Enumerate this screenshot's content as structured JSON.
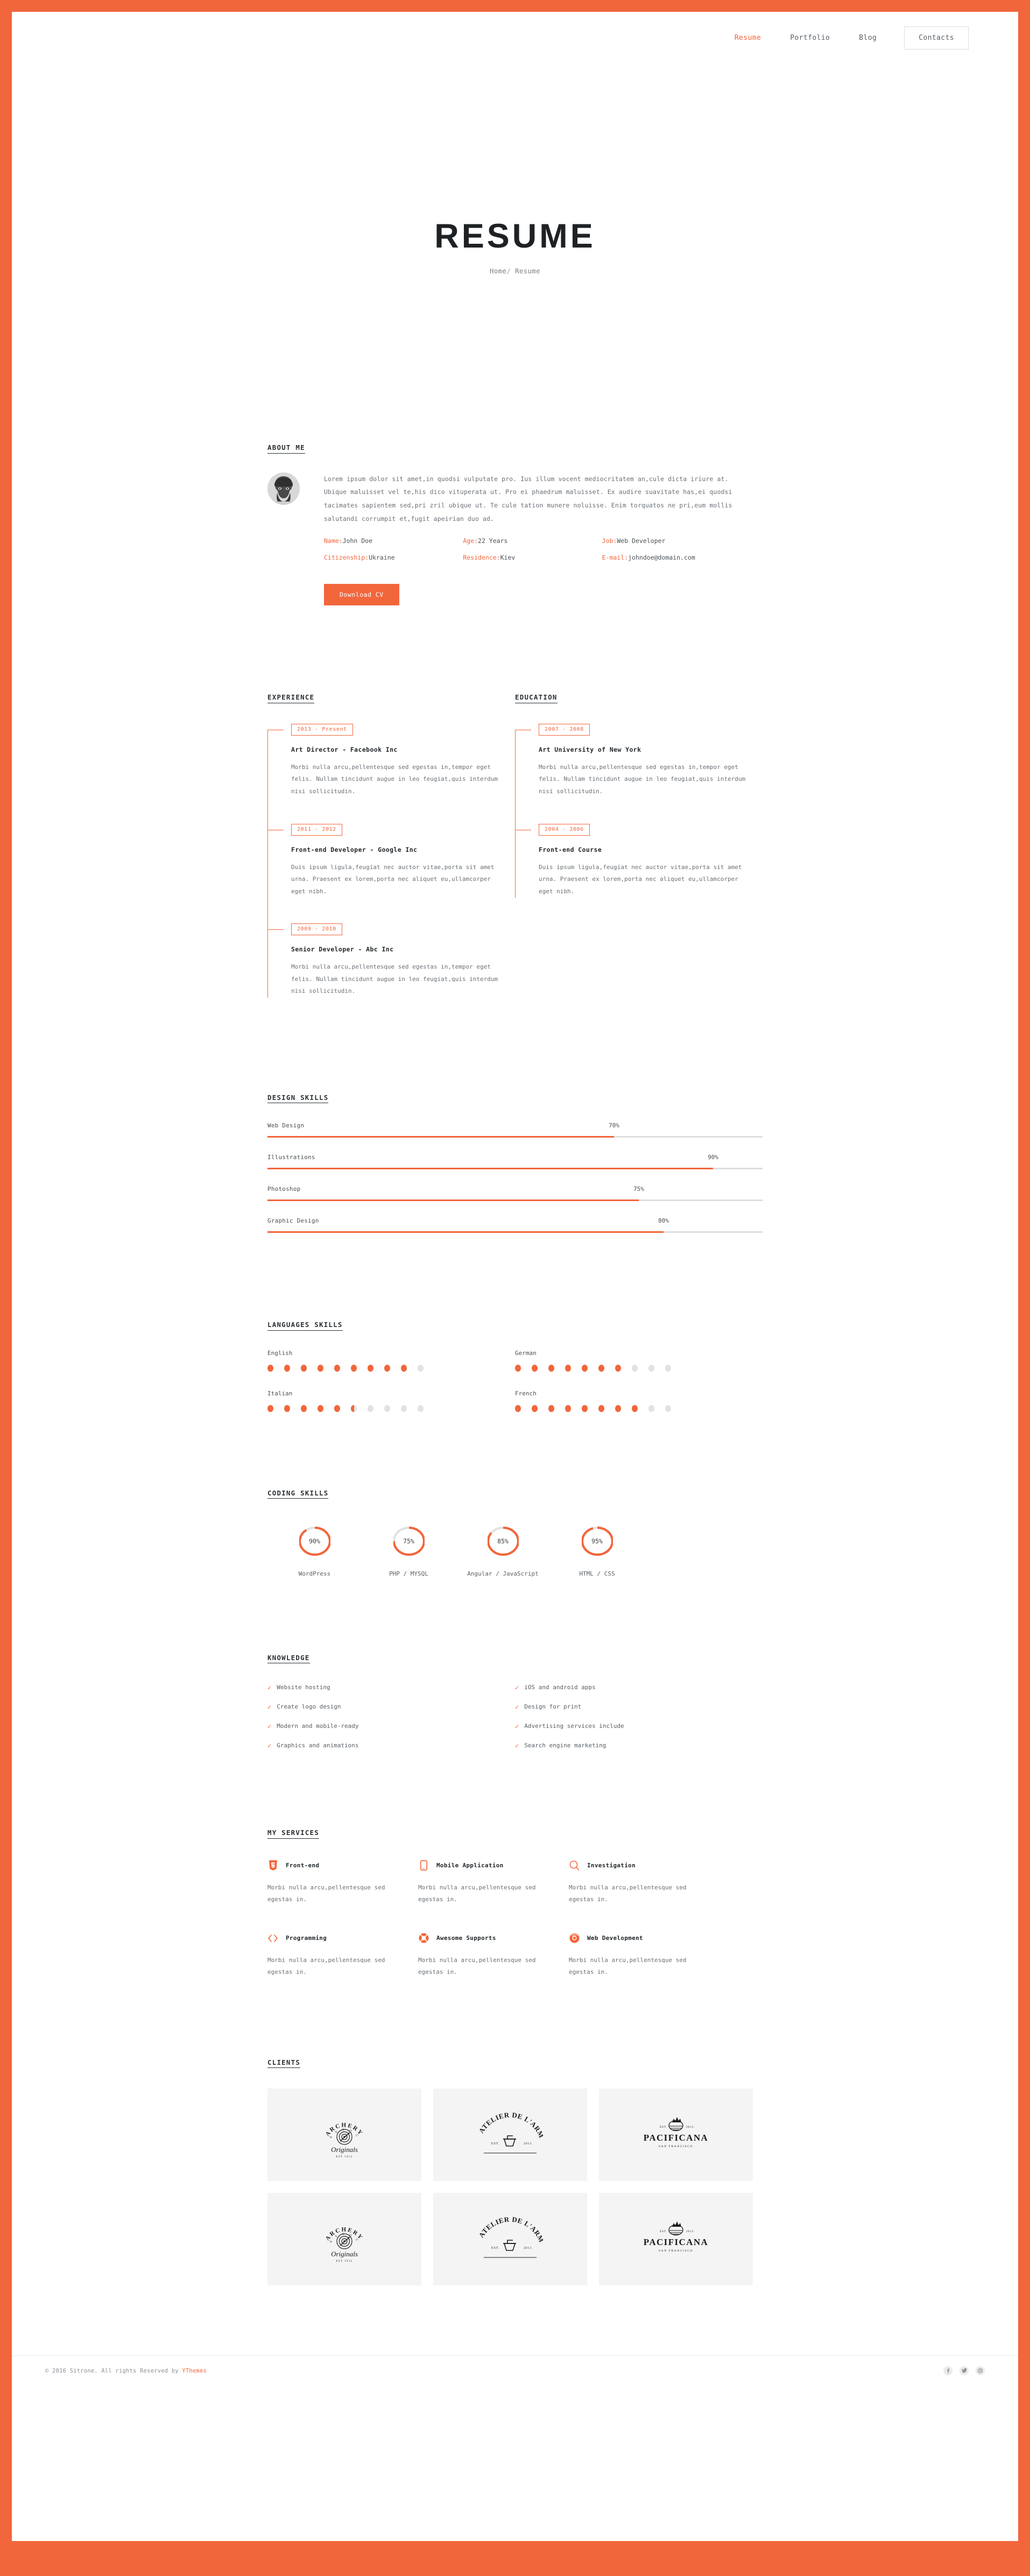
{
  "nav": {
    "links": [
      {
        "label": "Resume",
        "active": true
      },
      {
        "label": "Portfolio",
        "active": false
      },
      {
        "label": "Blog",
        "active": false
      }
    ],
    "button": "Contacts"
  },
  "hero": {
    "title": "RESUME",
    "breadcrumb_home": "Home",
    "breadcrumb_sep": "/",
    "breadcrumb_current": "Resume"
  },
  "about": {
    "heading": "ABOUT ME",
    "paragraph": "Lorem ipsum dolor sit amet,in quodsi vulputate pro. Ius illum vocent mediocritatem an,cule dicta iriure at. Ubique maluisset vel te,his dico vituperata ut. Pro ei phaedrum maluisset. Ex audire suavitate has,ei quodsi tacimates sapientem sed,pri zril ubique ut. Te cule tation munere noluisse. Enim torquatos ne pri,eum mollis salutandi corrumpit et,fugit apeirian duo ad.",
    "details": [
      {
        "label": "Name:",
        "value": "John Doe"
      },
      {
        "label": "Age:",
        "value": "22 Years"
      },
      {
        "label": "Job:",
        "value": "Web Developer"
      },
      {
        "label": "Citizenship:",
        "value": "Ukraine"
      },
      {
        "label": "Residence:",
        "value": "Kiev"
      },
      {
        "label": "E-mail:",
        "value": "johndoe@domain.com"
      }
    ],
    "cv_button": "Download CV"
  },
  "experience": {
    "heading": "EXPERIENCE",
    "items": [
      {
        "date": "2013 - Present",
        "role": "Art Director - Facebook Inc",
        "desc": "Morbi nulla arcu,pellentesque sed egestas in,tempor eget felis. Nullam tincidunt augue in leo feugiat,quis interdum nisi sollicitudin."
      },
      {
        "date": "2011 - 2012",
        "role": "Front-end Developer - Google Inc",
        "desc": "Duis ipsum ligula,feugiat nec auctor vitae,porta sit amet urna. Praesent ex lorem,porta nec aliquet eu,ullamcorper eget nibh."
      },
      {
        "date": "2009 - 2010",
        "role": "Senior Developer - Abc Inc",
        "desc": "Morbi nulla arcu,pellentesque sed egestas in,tempor eget felis. Nullam tincidunt augue in leo feugiat,quis interdum nisi sollicitudin."
      }
    ]
  },
  "education": {
    "heading": "EDUCATION",
    "items": [
      {
        "date": "2007 - 2008",
        "role": "Art University of New York",
        "desc": "Morbi nulla arcu,pellentesque sed egestas in,tempor eget felis. Nullam tincidunt augue in leo feugiat,quis interdum nisi sollicitudin."
      },
      {
        "date": "2004 - 2006",
        "role": "Front-end Course",
        "desc": "Duis ipsum ligula,feugiat nec auctor vitae,porta sit amet urna. Praesent ex lorem,porta nec aliquet eu,ullamcorper eget nibh."
      }
    ]
  },
  "design_skills": {
    "heading": "DESIGN SKILLS",
    "items": [
      {
        "name": "Web Design",
        "percent": 70,
        "percent_label": "70%"
      },
      {
        "name": "Illustrations",
        "percent": 90,
        "percent_label": "90%"
      },
      {
        "name": "Photoshop",
        "percent": 75,
        "percent_label": "75%"
      },
      {
        "name": "Graphic Design",
        "percent": 80,
        "percent_label": "80%"
      }
    ]
  },
  "language_skills": {
    "heading": "LANGUAGES SKILLS",
    "total_dots": 10,
    "items": [
      {
        "name": "English",
        "filled": 9,
        "half": false
      },
      {
        "name": "German",
        "filled": 7,
        "half": false
      },
      {
        "name": "Italian",
        "filled": 5,
        "half": true
      },
      {
        "name": "French",
        "filled": 8,
        "half": false
      }
    ]
  },
  "coding_skills": {
    "heading": "CODING SKILLS",
    "items": [
      {
        "label": "WordPress",
        "percent": 90,
        "percent_label": "90%"
      },
      {
        "label": "PHP / MYSQL",
        "percent": 75,
        "percent_label": "75%"
      },
      {
        "label": "Angular / JavaScript",
        "percent": 85,
        "percent_label": "85%"
      },
      {
        "label": "HTML / CSS",
        "percent": 95,
        "percent_label": "95%"
      }
    ]
  },
  "knowledge": {
    "heading": "KNOWLEDGE",
    "items": [
      "Website hosting",
      "iOS and android apps",
      "Create logo design",
      "Design for print",
      "Modern and mobile-ready",
      "Advertising services include",
      "Graphics and animations",
      "Search engine marketing"
    ]
  },
  "services": {
    "heading": "MY SERVICES",
    "items": [
      {
        "icon": "html5-icon",
        "title": "Front-end",
        "desc": "Morbi nulla arcu,pellentesque sed egestas in."
      },
      {
        "icon": "mobile-phone-icon",
        "title": "Mobile Application",
        "desc": "Morbi nulla arcu,pellentesque sed egestas in."
      },
      {
        "icon": "magnifier-icon",
        "title": "Investigation",
        "desc": "Morbi nulla arcu,pellentesque sed egestas in."
      },
      {
        "icon": "code-brackets-icon",
        "title": "Programming",
        "desc": "Morbi nulla arcu,pellentesque sed egestas in."
      },
      {
        "icon": "life-ring-icon",
        "title": "Awesome Supports",
        "desc": "Morbi nulla arcu,pellentesque sed egestas in."
      },
      {
        "icon": "chrome-icon",
        "title": "Web Development",
        "desc": "Morbi nulla arcu,pellentesque sed egestas in."
      }
    ]
  },
  "clients": {
    "heading": "CLIENTS",
    "items": [
      {
        "logo": "archery-logo",
        "name": "ARCHERY",
        "sub": "Originals",
        "est": "EST 1952"
      },
      {
        "logo": "atelier-logo",
        "name": "ATELIER DE L'ARMÉE",
        "sub": "EST.",
        "est": "2011"
      },
      {
        "logo": "pacificana-logo",
        "name": "PACIFICANA",
        "sub": "SAN FRANCISCO",
        "est": "EST. 2013"
      },
      {
        "logo": "archery-logo",
        "name": "ARCHERY",
        "sub": "Originals",
        "est": "EST 1952"
      },
      {
        "logo": "atelier-logo",
        "name": "ATELIER DE L'ARMÉE",
        "sub": "EST.",
        "est": "2011"
      },
      {
        "logo": "pacificana-logo",
        "name": "PACIFICANA",
        "sub": "SAN FRANCISCO",
        "est": "EST. 2013"
      }
    ]
  },
  "footer": {
    "copyright_pre": "© 2016 Sitrone. All rights Reserved by ",
    "brand": "YThemes",
    "socials": [
      "facebook-icon",
      "twitter-icon",
      "instagram-icon"
    ]
  },
  "colors": {
    "accent": "#f2663c",
    "highlight": "#f5f18a",
    "track": "#dedede",
    "text": "#3b4146"
  }
}
